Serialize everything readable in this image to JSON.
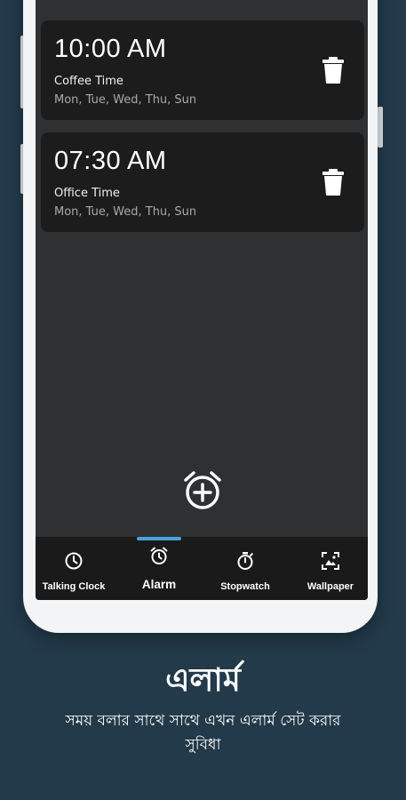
{
  "alarms": [
    {
      "time": "10:00 AM",
      "label": "Coffee Time",
      "days": "Mon, Tue, Wed, Thu, Sun"
    },
    {
      "time": "07:30 AM",
      "label": "Office Time",
      "days": "Mon, Tue, Wed, Thu, Sun"
    }
  ],
  "nav": {
    "talking_clock": "Talking Clock",
    "alarm": "Alarm",
    "stopwatch": "Stopwatch",
    "wallpaper": "Wallpaper"
  },
  "promo": {
    "title": "এলার্ম",
    "subtitle": "সময় বলার সাথে সাথে এখন এলার্ম সেট করার সুবিধা"
  },
  "colors": {
    "background": "#233a4a",
    "screen": "#2f3032",
    "card": "#1c1c1d",
    "nav_bar": "#1a1a1b",
    "accent": "#4aa2d8"
  },
  "icons": {
    "delete": "trash-icon",
    "add_alarm": "alarm-add-icon",
    "talking_clock": "clock-icon",
    "alarm": "alarm-icon",
    "stopwatch": "stopwatch-icon",
    "wallpaper": "wallpaper-icon"
  }
}
